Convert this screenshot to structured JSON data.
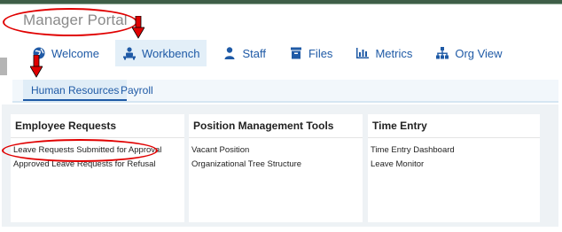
{
  "app": {
    "title": "Manager Portal"
  },
  "nav": {
    "items": [
      {
        "label": "Welcome",
        "icon": "globe-icon"
      },
      {
        "label": "Workbench",
        "icon": "workbench-icon",
        "active": true
      },
      {
        "label": "Staff",
        "icon": "person-icon"
      },
      {
        "label": "Files",
        "icon": "file-icon"
      },
      {
        "label": "Metrics",
        "icon": "bar-chart-icon"
      },
      {
        "label": "Org View",
        "icon": "org-chart-icon"
      }
    ]
  },
  "subtabs": [
    {
      "label": "Human Resources",
      "active": true
    },
    {
      "label": "Payroll"
    }
  ],
  "panels": [
    {
      "title": "Employee Requests",
      "links": [
        "Leave Requests Submitted for Approval",
        "Approved Leave Requests for Refusal"
      ]
    },
    {
      "title": "Position Management Tools",
      "links": [
        "Vacant Position",
        "Organizational Tree Structure"
      ]
    },
    {
      "title": "Time Entry",
      "links": [
        "Time Entry Dashboard",
        "Leave Monitor"
      ]
    }
  ],
  "colors": {
    "accent": "#1f5aa6",
    "annotation": "#e00000",
    "top_strip": "#3e5e47"
  }
}
